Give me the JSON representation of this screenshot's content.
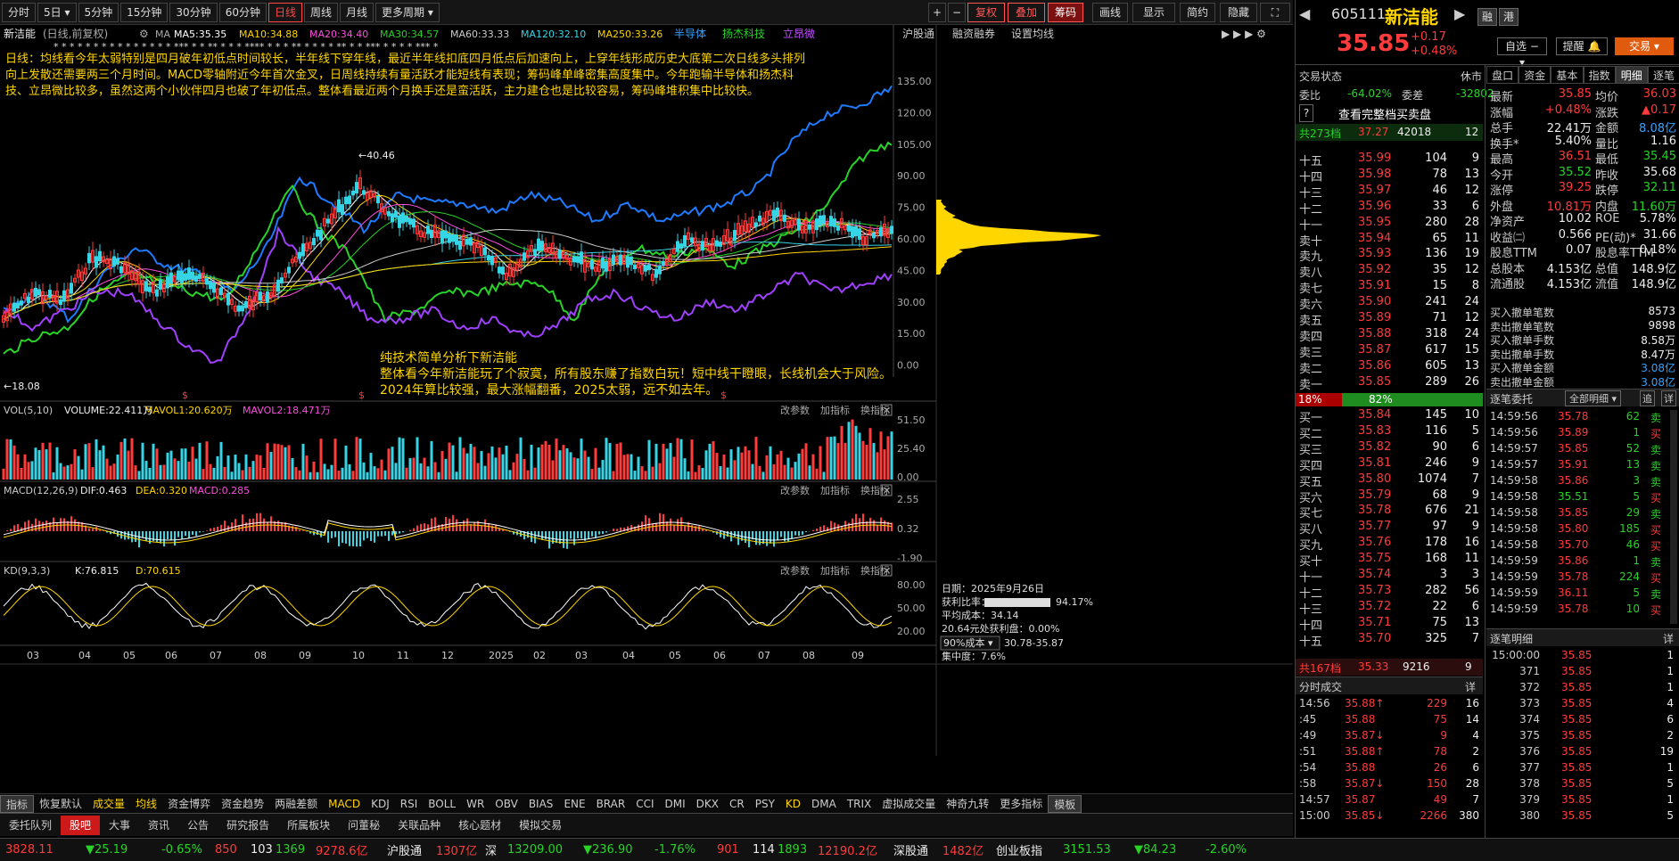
{
  "periods": [
    "分时",
    "5日",
    "5分钟",
    "15分钟",
    "30分钟",
    "60分钟",
    "日线",
    "周线",
    "月线",
    "更多周期"
  ],
  "active_period": "日线",
  "toptools": [
    "复权",
    "叠加",
    "筹码",
    "画线",
    "显示",
    "简约",
    "隐藏"
  ],
  "stock": {
    "code": "605111",
    "name": "新洁能",
    "price": "35.85",
    "change": "+0.17",
    "pct": "+0.48%"
  },
  "chart_title": "新洁能",
  "chart_mode": "(日线,前复权)",
  "ma": {
    "label": "MA",
    "ma5": "MA5:35.35",
    "ma10": "MA10:34.88",
    "ma20": "MA20:34.40",
    "ma30": "MA30:34.57",
    "ma60": "MA60:33.33",
    "ma120": "MA120:32.10",
    "ma250": "MA250:33.26"
  },
  "overlays": [
    "半导体",
    "扬杰科技",
    "立昂微"
  ],
  "chart_links": [
    "沪股通",
    "融资融券",
    "设置均线"
  ],
  "annotation_top": "日线：均线看今年太弱特别是四月破年初低点时间较长，半年线下穿年线，最近半年线扣底四月低点后加速向上，上穿年线形成历史大底第二次日线多头排列向上发散还需要两三个月时间。MACD零轴附近今年首次金叉，日周线持续有量活跃才能短线有表现；筹码峰单峰密集高度集中。今年跑输半导体和扬杰科技、立昂微比较多，虽然这两个小伙伴四月也破了年初低点。整体看最近两个月换手还是蛮活跃，主力建仓也是比较容易，筹码峰堆积集中比较快。",
  "annotation_bottom": [
    "纯技术简单分析下新洁能",
    "整体看今年新洁能玩了个寂寞，所有股东赚了指数白玩！短中线干瞪眼，长线机会大于风险。",
    "2024年算比较强，最大涨幅翻番，2025太弱，远不如去年。"
  ],
  "price_axis": [
    "135.00",
    "120.00",
    "105.00",
    "90.00",
    "75.00",
    "60.00",
    "45.00",
    "30.00",
    "15.00",
    "0.00"
  ],
  "high_mark": "40.46",
  "low_mark": "18.08",
  "vol": {
    "label": "VOL(5,10)",
    "v": "VOLUME:22.411万",
    "m1": "MAVOL1:20.620万",
    "m2": "MAVOL2:18.471万",
    "axis": [
      "51.50",
      "25.40",
      "0.00"
    ]
  },
  "macd": {
    "label": "MACD(12,26,9)",
    "dif": "DIF:0.463",
    "dea": "DEA:0.320",
    "m": "MACD:0.285",
    "axis": [
      "2.55",
      "0.32",
      "-1.90"
    ]
  },
  "kd": {
    "label": "KD(9,3,3)",
    "k": "K:76.815",
    "d": "D:70.615",
    "axis": [
      "80.00",
      "50.00",
      "20.00"
    ]
  },
  "panel_btns": [
    "改参数",
    "加指标",
    "换指标"
  ],
  "time_axis": [
    "03",
    "04",
    "05",
    "06",
    "07",
    "08",
    "09",
    "10",
    "11",
    "12",
    "2025",
    "02",
    "03",
    "04",
    "05",
    "06",
    "07",
    "08",
    "09"
  ],
  "chip": {
    "date": "日期：2025年9月26日",
    "profit_label": "获利比率：",
    "profit": "94.17%",
    "avg": "平均成本：34.14",
    "profit_at": "20.64元处获利盘：0.00%",
    "cost_sel": "90%成本",
    "cost_range": "30.78-35.87",
    "conc": "集中度：7.6%"
  },
  "indicators": [
    "指标",
    "恢复默认",
    "成交量",
    "均线",
    "资金博弈",
    "资金趋势",
    "两融差额",
    "MACD",
    "KDJ",
    "RSI",
    "BOLL",
    "WR",
    "OBV",
    "BIAS",
    "ENE",
    "BRAR",
    "CCI",
    "DMI",
    "DKX",
    "CR",
    "PSY",
    "KD",
    "DMA",
    "TRIX",
    "虚拟成交量",
    "神奇九转",
    "更多指标",
    "模板"
  ],
  "bottom_tabs": [
    "委托队列",
    "股吧",
    "大事",
    "资讯",
    "公告",
    "研究报告",
    "所属板块",
    "问董秘",
    "关联品种",
    "核心题材",
    "模拟交易"
  ],
  "qtop": {
    "rong": "融",
    "gang": "港",
    "zixuan": "自选",
    "tixing": "提醒",
    "jiaoyi": "交易"
  },
  "trade_state": {
    "label": "交易状态",
    "val": "休市"
  },
  "weibi": {
    "label": "委比",
    "val": "-64.02%",
    "label2": "委差",
    "val2": "-32802"
  },
  "view_all": "查看完整档买卖盘",
  "ask_total": {
    "label": "共273档",
    "p": "37.27",
    "v": "42018",
    "n": "12"
  },
  "asks": [
    [
      "十五",
      "35.99",
      "104",
      "9"
    ],
    [
      "十四",
      "35.98",
      "78",
      "13"
    ],
    [
      "十三",
      "35.97",
      "46",
      "12"
    ],
    [
      "十二",
      "35.96",
      "33",
      "6"
    ],
    [
      "十一",
      "35.95",
      "280",
      "28"
    ],
    [
      "卖十",
      "35.94",
      "65",
      "11"
    ],
    [
      "卖九",
      "35.93",
      "136",
      "19"
    ],
    [
      "卖八",
      "35.92",
      "35",
      "12"
    ],
    [
      "卖七",
      "35.91",
      "15",
      "8"
    ],
    [
      "卖六",
      "35.90",
      "241",
      "24"
    ],
    [
      "卖五",
      "35.89",
      "71",
      "12"
    ],
    [
      "卖四",
      "35.88",
      "318",
      "24"
    ],
    [
      "卖三",
      "35.87",
      "617",
      "15"
    ],
    [
      "卖二",
      "35.86",
      "605",
      "13"
    ],
    [
      "卖一",
      "35.85",
      "289",
      "26"
    ]
  ],
  "ratio": {
    "buy": "18%",
    "sell": "82%"
  },
  "bids": [
    [
      "买一",
      "35.84",
      "145",
      "10"
    ],
    [
      "买二",
      "35.83",
      "116",
      "5"
    ],
    [
      "买三",
      "35.82",
      "90",
      "6"
    ],
    [
      "买四",
      "35.81",
      "246",
      "9"
    ],
    [
      "买五",
      "35.80",
      "1074",
      "7"
    ],
    [
      "买六",
      "35.79",
      "68",
      "9"
    ],
    [
      "买七",
      "35.78",
      "676",
      "21"
    ],
    [
      "买八",
      "35.77",
      "97",
      "9"
    ],
    [
      "买九",
      "35.76",
      "178",
      "16"
    ],
    [
      "买十",
      "35.75",
      "168",
      "11"
    ],
    [
      "十一",
      "35.74",
      "3",
      "3"
    ],
    [
      "十二",
      "35.73",
      "282",
      "56"
    ],
    [
      "十三",
      "35.72",
      "22",
      "6"
    ],
    [
      "十四",
      "35.71",
      "75",
      "13"
    ],
    [
      "十五",
      "35.70",
      "325",
      "7"
    ]
  ],
  "bid_total": {
    "label": "共167档",
    "p": "35.33",
    "v": "9216",
    "n": "9"
  },
  "tabs_r": [
    "盘口",
    "资金",
    "基本",
    "指数",
    "明细",
    "逐笔"
  ],
  "stats": [
    [
      "最新",
      "35.85",
      "均价",
      "36.03"
    ],
    [
      "涨幅",
      "+0.48%",
      "涨跌",
      "▲0.17"
    ],
    [
      "总手",
      "22.41万",
      "金额",
      "8.08亿"
    ],
    [
      "换手*",
      "5.40%",
      "量比",
      "1.16"
    ],
    [
      "最高",
      "36.51",
      "最低",
      "35.45"
    ],
    [
      "今开",
      "35.52",
      "昨收",
      "35.68"
    ],
    [
      "涨停",
      "39.25",
      "跌停",
      "32.11"
    ],
    [
      "外盘",
      "10.81万",
      "内盘",
      "11.60万"
    ],
    [
      "净资产",
      "10.02",
      "ROE",
      "5.78%"
    ],
    [
      "收益㈡",
      "0.566",
      "PE(动)*",
      "31.66"
    ],
    [
      "股息TTM",
      "0.07",
      "股息率TTM",
      "0.18%"
    ],
    [
      "总股本",
      "4.153亿",
      "总值",
      "148.9亿"
    ],
    [
      "流通股",
      "4.153亿",
      "流值",
      "148.9亿"
    ]
  ],
  "withdraw": [
    [
      "买入撤单笔数",
      "8573"
    ],
    [
      "卖出撤单笔数",
      "9898"
    ],
    [
      "买入撤单手数",
      "8.58万"
    ],
    [
      "卖出撤单手数",
      "8.47万"
    ],
    [
      "买入撤单金额",
      "3.08亿"
    ],
    [
      "卖出撤单金额",
      "3.08亿"
    ]
  ],
  "zbwt": {
    "label": "逐笔委托",
    "sel": "全部明细",
    "zhui": "追",
    "xiang": "详"
  },
  "orders": [
    [
      "14:59:56",
      "35.78",
      "62",
      "卖"
    ],
    [
      "14:59:56",
      "35.89",
      "1",
      "买"
    ],
    [
      "14:59:57",
      "35.85",
      "52",
      "卖"
    ],
    [
      "14:59:57",
      "35.91",
      "13",
      "卖"
    ],
    [
      "14:59:58",
      "35.86",
      "3",
      "卖"
    ],
    [
      "14:59:58",
      "35.51",
      "5",
      "买"
    ],
    [
      "14:59:58",
      "35.85",
      "29",
      "卖"
    ],
    [
      "14:59:58",
      "35.80",
      "185",
      "买"
    ],
    [
      "14:59:58",
      "35.70",
      "46",
      "买"
    ],
    [
      "14:59:59",
      "35.86",
      "1",
      "卖"
    ],
    [
      "14:59:59",
      "35.78",
      "224",
      "买"
    ],
    [
      "14:59:59",
      "36.11",
      "5",
      "卖"
    ],
    [
      "14:59:59",
      "35.78",
      "10",
      "买"
    ]
  ],
  "fenshi": {
    "label": "分时成交",
    "xiang": "详"
  },
  "ticks": [
    [
      "14:56",
      "35.88↑",
      "229",
      "16"
    ],
    [
      ":45",
      "35.88",
      "75",
      "14"
    ],
    [
      ":49",
      "35.87↓",
      "9",
      "4"
    ],
    [
      ":51",
      "35.88↑",
      "78",
      "2"
    ],
    [
      ":54",
      "35.88",
      "26",
      "6"
    ],
    [
      ":58",
      "35.87↓",
      "150",
      "28"
    ],
    [
      "14:57",
      "35.87",
      "49",
      "7"
    ],
    [
      "15:00",
      "35.85↓",
      "2266",
      "380"
    ]
  ],
  "zbmx": {
    "label": "逐笔明细",
    "xiang": "详"
  },
  "details": [
    [
      "15:00:00",
      "35.85",
      "1"
    ],
    [
      "371",
      "35.85",
      "1"
    ],
    [
      "372",
      "35.85",
      "1"
    ],
    [
      "373",
      "35.85",
      "4"
    ],
    [
      "374",
      "35.85",
      "6"
    ],
    [
      "375",
      "35.85",
      "2"
    ],
    [
      "376",
      "35.85",
      "19"
    ],
    [
      "377",
      "35.85",
      "1"
    ],
    [
      "378",
      "35.85",
      "5"
    ],
    [
      "379",
      "35.85",
      "1"
    ],
    [
      "380",
      "35.85",
      "5"
    ]
  ],
  "status": [
    "3828.11",
    "▼25.19",
    "-0.65%",
    "850",
    "103",
    "1369",
    "9278.6亿",
    "沪股通",
    "1307亿",
    "深",
    "13209.00",
    "▼236.90",
    "-1.76%",
    "901",
    "114",
    "1893",
    "12190.2亿",
    "深股通",
    "1482亿",
    "创业板指",
    "3151.53",
    "▼84.23",
    "-2.60%"
  ],
  "colors": {
    "up": "#ff3b3b",
    "down": "#27d327",
    "ma5": "#ffffff",
    "ma10": "#ffd600",
    "ma20": "#ff4de0",
    "ma30": "#27d327",
    "ma60": "#cccccc",
    "ma120": "#36d5e6",
    "ma250": "#ffd600"
  }
}
